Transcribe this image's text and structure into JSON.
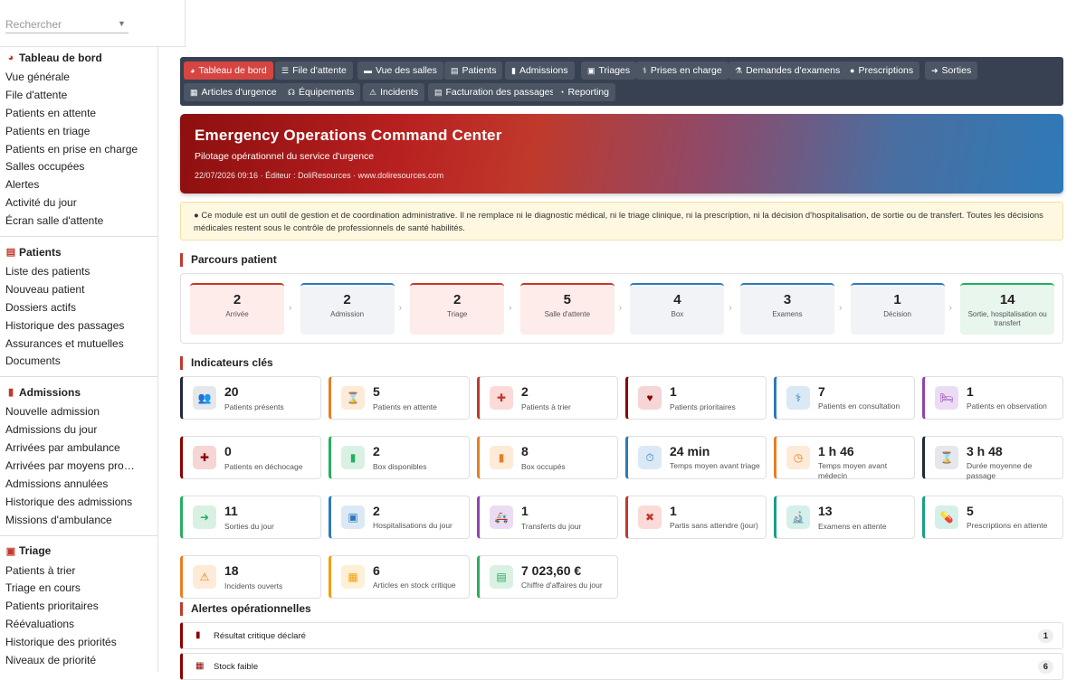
{
  "search": {
    "placeholder": "Rechercher"
  },
  "sidebar": {
    "groups": [
      {
        "title": "Tableau de bord",
        "icon": "dashboard-icon",
        "items": [
          "Vue générale",
          "File d'attente",
          "Patients en attente",
          "Patients en triage",
          "Patients en prise en charge",
          "Salles occupées",
          "Alertes",
          "Activité du jour",
          "Écran salle d'attente"
        ]
      },
      {
        "title": "Patients",
        "icon": "id-card-icon",
        "items": [
          "Liste des patients",
          "Nouveau patient",
          "Dossiers actifs",
          "Historique des passages",
          "Assurances et mutuelles",
          "Documents"
        ]
      },
      {
        "title": "Admissions",
        "icon": "door-icon",
        "items": [
          "Nouvelle admission",
          "Admissions du jour",
          "Arrivées par ambulance",
          "Arrivées par moyens pro…",
          "Admissions annulées",
          "Historique des admissions",
          "Missions d'ambulance"
        ]
      },
      {
        "title": "Triage",
        "icon": "clipboard-icon",
        "items": [
          "Patients à trier",
          "Triage en cours",
          "Patients prioritaires",
          "Réévaluations",
          "Historique des priorités",
          "Niveaux de priorité"
        ]
      }
    ]
  },
  "nav": [
    {
      "label": "Tableau de bord",
      "icon": "dashboard-icon",
      "active": true
    },
    {
      "label": "File d'attente",
      "icon": "list-icon"
    },
    {
      "label": "Vue des salles",
      "icon": "bed-icon"
    },
    {
      "label": "Patients",
      "icon": "id-card-icon"
    },
    {
      "label": "Admissions",
      "icon": "door-icon"
    },
    {
      "label": "Triages",
      "icon": "clipboard-icon"
    },
    {
      "label": "Prises en charge",
      "icon": "user-md-icon"
    },
    {
      "label": "Demandes d'examens",
      "icon": "microscope-icon"
    },
    {
      "label": "Prescriptions",
      "icon": "pills-icon"
    },
    {
      "label": "Sorties",
      "icon": "sign-out-icon"
    },
    {
      "label": "Articles d'urgence",
      "icon": "boxes-icon"
    },
    {
      "label": "Équipements",
      "icon": "stethoscope-icon"
    },
    {
      "label": "Incidents",
      "icon": "warning-icon"
    },
    {
      "label": "Facturation des passages",
      "icon": "invoice-icon"
    },
    {
      "label": "Reporting",
      "icon": "pie-chart-icon"
    }
  ],
  "hero": {
    "title": "Emergency Operations Command Center",
    "subtitle": "Pilotage opérationnel du service d'urgence",
    "meta": "22/07/2026 09:16 · Éditeur : DoliResources · www.doliresources.com"
  },
  "notice": {
    "text": "Ce module est un outil de gestion et de coordination administrative. Il ne remplace ni le diagnostic médical, ni le triage clinique, ni la prescription, ni la décision d'hospitalisation, de sortie ou de transfert. Toutes les décisions médicales restent sous le contrôle de professionnels de santé habilités."
  },
  "parcours": {
    "title": "Parcours patient",
    "steps": [
      {
        "value": "2",
        "label": "Arrivée",
        "tone": "red"
      },
      {
        "value": "2",
        "label": "Admission",
        "tone": "blue"
      },
      {
        "value": "2",
        "label": "Triage",
        "tone": "red"
      },
      {
        "value": "5",
        "label": "Salle d'attente",
        "tone": "red"
      },
      {
        "value": "4",
        "label": "Box",
        "tone": "blue"
      },
      {
        "value": "3",
        "label": "Examens",
        "tone": "blue"
      },
      {
        "value": "1",
        "label": "Décision",
        "tone": "blue"
      },
      {
        "value": "14",
        "label": "Sortie, hospitalisation ou transfert",
        "tone": "green"
      }
    ]
  },
  "kpis": {
    "title": "Indicateurs clés",
    "items": [
      {
        "value": "20",
        "label": "Patients présents",
        "icon": "users-icon",
        "color": "#1f2937",
        "bg": "#e5e7eb",
        "glyph": "👥"
      },
      {
        "value": "5",
        "label": "Patients en attente",
        "icon": "hourglass-icon",
        "color": "#e67e22",
        "bg": "#fdebd8",
        "glyph": "⌛"
      },
      {
        "value": "2",
        "label": "Patients à trier",
        "icon": "clipboard-check-icon",
        "color": "#c0392b",
        "bg": "#fadbd8",
        "glyph": "✚"
      },
      {
        "value": "1",
        "label": "Patients prioritaires",
        "icon": "heart-pulse-icon",
        "color": "#8b0000",
        "bg": "#f5d5d5",
        "glyph": "♥"
      },
      {
        "value": "7",
        "label": "Patients en consultation",
        "icon": "user-md-icon",
        "color": "#2e7ab8",
        "bg": "#dbe9f6",
        "glyph": "⚕"
      },
      {
        "value": "1",
        "label": "Patients en observation",
        "icon": "bed-icon",
        "color": "#8e44ad",
        "bg": "#ebdcf3",
        "glyph": "🛏"
      },
      {
        "value": "0",
        "label": "Patients en déchocage",
        "icon": "procedures-icon",
        "color": "#8b0000",
        "bg": "#f5d5d5",
        "glyph": "✚"
      },
      {
        "value": "2",
        "label": "Box disponibles",
        "icon": "door-open-icon",
        "color": "#27ae60",
        "bg": "#d9f1e3",
        "glyph": "▮"
      },
      {
        "value": "8",
        "label": "Box occupés",
        "icon": "door-closed-icon",
        "color": "#e67e22",
        "bg": "#fdebd8",
        "glyph": "▮"
      },
      {
        "value": "24 min",
        "label": "Temps moyen avant triage",
        "icon": "stopwatch-icon",
        "color": "#2e7ab8",
        "bg": "#dbe9f6",
        "glyph": "⏱"
      },
      {
        "value": "1 h 46",
        "label": "Temps moyen avant médecin",
        "icon": "clock-icon",
        "color": "#e67e22",
        "bg": "#fdebd8",
        "glyph": "◷"
      },
      {
        "value": "3 h 48",
        "label": "Durée moyenne de passage",
        "icon": "hourglass-end-icon",
        "color": "#1f2937",
        "bg": "#e5e7eb",
        "glyph": "⌛"
      },
      {
        "value": "11",
        "label": "Sorties du jour",
        "icon": "sign-out-icon",
        "color": "#27ae60",
        "bg": "#d9f1e3",
        "glyph": "➜"
      },
      {
        "value": "2",
        "label": "Hospitalisations du jour",
        "icon": "hospital-icon",
        "color": "#2e7ab8",
        "bg": "#dbe9f6",
        "glyph": "▣"
      },
      {
        "value": "1",
        "label": "Transferts du jour",
        "icon": "ambulance-icon",
        "color": "#8e44ad",
        "bg": "#ebdcf3",
        "glyph": "🚑"
      },
      {
        "value": "1",
        "label": "Partis sans attendre (jour)",
        "icon": "user-slash-icon",
        "color": "#c0392b",
        "bg": "#fadbd8",
        "glyph": "✖"
      },
      {
        "value": "13",
        "label": "Examens en attente",
        "icon": "microscope-icon",
        "color": "#16a085",
        "bg": "#d5f0ea",
        "glyph": "🔬"
      },
      {
        "value": "5",
        "label": "Prescriptions en attente",
        "icon": "pills-icon",
        "color": "#16a085",
        "bg": "#d5f0ea",
        "glyph": "💊"
      },
      {
        "value": "18",
        "label": "Incidents ouverts",
        "icon": "warning-icon",
        "color": "#e67e22",
        "bg": "#fdebd8",
        "glyph": "⚠"
      },
      {
        "value": "6",
        "label": "Articles en stock critique",
        "icon": "boxes-icon",
        "color": "#f39c12",
        "bg": "#fdf0d5",
        "glyph": "▦"
      },
      {
        "value": "7 023,60 €",
        "label": "Chiffre d'affaires du jour",
        "icon": "invoice-icon",
        "color": "#27ae60",
        "bg": "#d9f1e3",
        "glyph": "▤"
      }
    ]
  },
  "alerts": {
    "title": "Alertes opérationnelles",
    "items": [
      {
        "label": "Résultat critique déclaré",
        "count": "1",
        "icon": "file-medical-icon"
      },
      {
        "label": "Stock faible",
        "count": "6",
        "icon": "boxes-icon"
      }
    ]
  },
  "colors": {
    "accent": "#d64541",
    "nav_bg": "#374151",
    "nav_btn": "#4b5563"
  }
}
